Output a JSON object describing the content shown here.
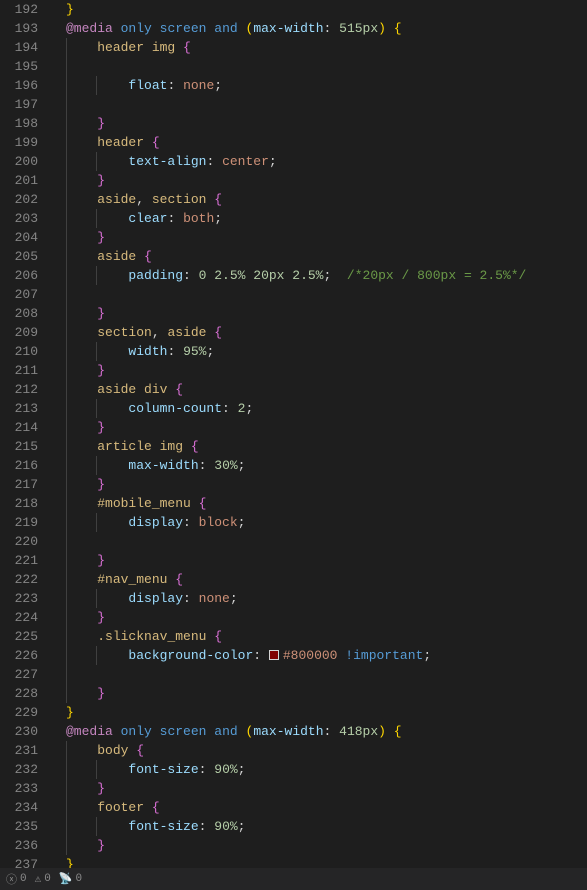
{
  "gutter": {
    "start": 192,
    "end": 237
  },
  "lines": [
    {
      "indent": 0,
      "tokens": [
        {
          "t": "paren-y",
          "v": "}"
        }
      ]
    },
    {
      "indent": 0,
      "tokens": [
        {
          "t": "atrule",
          "v": "@media"
        },
        {
          "t": "sp"
        },
        {
          "t": "keyword",
          "v": "only"
        },
        {
          "t": "sp"
        },
        {
          "t": "keyword",
          "v": "screen"
        },
        {
          "t": "sp"
        },
        {
          "t": "keyword",
          "v": "and"
        },
        {
          "t": "sp"
        },
        {
          "t": "paren-y",
          "v": "("
        },
        {
          "t": "prop",
          "v": "max-width"
        },
        {
          "t": "punct",
          "v": ":"
        },
        {
          "t": "sp"
        },
        {
          "t": "num",
          "v": "515px"
        },
        {
          "t": "paren-y",
          "v": ")"
        },
        {
          "t": "sp"
        },
        {
          "t": "paren-y",
          "v": "{"
        }
      ]
    },
    {
      "indent": 1,
      "tokens": [
        {
          "t": "sel",
          "v": "header img"
        },
        {
          "t": "sp"
        },
        {
          "t": "paren-p",
          "v": "{"
        }
      ]
    },
    {
      "indent": 1,
      "tokens": []
    },
    {
      "indent": 2,
      "tokens": [
        {
          "t": "prop",
          "v": "float"
        },
        {
          "t": "punct",
          "v": ":"
        },
        {
          "t": "sp"
        },
        {
          "t": "val",
          "v": "none"
        },
        {
          "t": "punct",
          "v": ";"
        }
      ]
    },
    {
      "indent": 1,
      "tokens": []
    },
    {
      "indent": 1,
      "tokens": [
        {
          "t": "paren-p",
          "v": "}"
        }
      ]
    },
    {
      "indent": 1,
      "tokens": [
        {
          "t": "sel",
          "v": "header"
        },
        {
          "t": "sp"
        },
        {
          "t": "paren-p",
          "v": "{"
        }
      ]
    },
    {
      "indent": 2,
      "tokens": [
        {
          "t": "prop",
          "v": "text-align"
        },
        {
          "t": "punct",
          "v": ":"
        },
        {
          "t": "sp"
        },
        {
          "t": "val",
          "v": "center"
        },
        {
          "t": "punct",
          "v": ";"
        }
      ]
    },
    {
      "indent": 1,
      "tokens": [
        {
          "t": "paren-p",
          "v": "}"
        }
      ]
    },
    {
      "indent": 1,
      "tokens": [
        {
          "t": "sel",
          "v": "aside"
        },
        {
          "t": "punct",
          "v": ","
        },
        {
          "t": "sp"
        },
        {
          "t": "sel",
          "v": "section"
        },
        {
          "t": "sp"
        },
        {
          "t": "paren-p",
          "v": "{"
        }
      ]
    },
    {
      "indent": 2,
      "tokens": [
        {
          "t": "prop",
          "v": "clear"
        },
        {
          "t": "punct",
          "v": ":"
        },
        {
          "t": "sp"
        },
        {
          "t": "val",
          "v": "both"
        },
        {
          "t": "punct",
          "v": ";"
        }
      ]
    },
    {
      "indent": 1,
      "tokens": [
        {
          "t": "paren-p",
          "v": "}"
        }
      ]
    },
    {
      "indent": 1,
      "tokens": [
        {
          "t": "sel",
          "v": "aside"
        },
        {
          "t": "sp"
        },
        {
          "t": "paren-p",
          "v": "{"
        }
      ]
    },
    {
      "indent": 2,
      "tokens": [
        {
          "t": "prop",
          "v": "padding"
        },
        {
          "t": "punct",
          "v": ":"
        },
        {
          "t": "sp"
        },
        {
          "t": "num",
          "v": "0 2.5% 20px 2.5%"
        },
        {
          "t": "punct",
          "v": ";"
        },
        {
          "t": "sp"
        },
        {
          "t": "sp"
        },
        {
          "t": "comment",
          "v": "/*20px / 800px = 2.5%*/"
        }
      ]
    },
    {
      "indent": 1,
      "tokens": []
    },
    {
      "indent": 1,
      "tokens": [
        {
          "t": "paren-p",
          "v": "}"
        }
      ]
    },
    {
      "indent": 1,
      "tokens": [
        {
          "t": "sel",
          "v": "section"
        },
        {
          "t": "punct",
          "v": ","
        },
        {
          "t": "sp"
        },
        {
          "t": "sel",
          "v": "aside"
        },
        {
          "t": "sp"
        },
        {
          "t": "paren-p",
          "v": "{"
        }
      ]
    },
    {
      "indent": 2,
      "tokens": [
        {
          "t": "prop",
          "v": "width"
        },
        {
          "t": "punct",
          "v": ":"
        },
        {
          "t": "sp"
        },
        {
          "t": "num",
          "v": "95%"
        },
        {
          "t": "punct",
          "v": ";"
        }
      ]
    },
    {
      "indent": 1,
      "tokens": [
        {
          "t": "paren-p",
          "v": "}"
        }
      ]
    },
    {
      "indent": 1,
      "tokens": [
        {
          "t": "sel",
          "v": "aside div"
        },
        {
          "t": "sp"
        },
        {
          "t": "paren-p",
          "v": "{"
        }
      ]
    },
    {
      "indent": 2,
      "tokens": [
        {
          "t": "prop",
          "v": "column-count"
        },
        {
          "t": "punct",
          "v": ":"
        },
        {
          "t": "sp"
        },
        {
          "t": "num",
          "v": "2"
        },
        {
          "t": "punct",
          "v": ";"
        }
      ]
    },
    {
      "indent": 1,
      "tokens": [
        {
          "t": "paren-p",
          "v": "}"
        }
      ]
    },
    {
      "indent": 1,
      "tokens": [
        {
          "t": "sel",
          "v": "article img"
        },
        {
          "t": "sp"
        },
        {
          "t": "paren-p",
          "v": "{"
        }
      ]
    },
    {
      "indent": 2,
      "tokens": [
        {
          "t": "prop",
          "v": "max-width"
        },
        {
          "t": "punct",
          "v": ":"
        },
        {
          "t": "sp"
        },
        {
          "t": "num",
          "v": "30%"
        },
        {
          "t": "punct",
          "v": ";"
        }
      ]
    },
    {
      "indent": 1,
      "tokens": [
        {
          "t": "paren-p",
          "v": "}"
        }
      ]
    },
    {
      "indent": 1,
      "tokens": [
        {
          "t": "sel",
          "v": "#mobile_menu"
        },
        {
          "t": "sp"
        },
        {
          "t": "paren-p",
          "v": "{"
        }
      ]
    },
    {
      "indent": 2,
      "tokens": [
        {
          "t": "prop",
          "v": "display"
        },
        {
          "t": "punct",
          "v": ":"
        },
        {
          "t": "sp"
        },
        {
          "t": "val",
          "v": "block"
        },
        {
          "t": "punct",
          "v": ";"
        }
      ]
    },
    {
      "indent": 1,
      "tokens": []
    },
    {
      "indent": 1,
      "tokens": [
        {
          "t": "paren-p",
          "v": "}"
        }
      ]
    },
    {
      "indent": 1,
      "tokens": [
        {
          "t": "sel",
          "v": "#nav_menu"
        },
        {
          "t": "sp"
        },
        {
          "t": "paren-p",
          "v": "{"
        }
      ]
    },
    {
      "indent": 2,
      "tokens": [
        {
          "t": "prop",
          "v": "display"
        },
        {
          "t": "punct",
          "v": ":"
        },
        {
          "t": "sp"
        },
        {
          "t": "val",
          "v": "none"
        },
        {
          "t": "punct",
          "v": ";"
        }
      ]
    },
    {
      "indent": 1,
      "tokens": [
        {
          "t": "paren-p",
          "v": "}"
        }
      ]
    },
    {
      "indent": 1,
      "tokens": [
        {
          "t": "sel",
          "v": ".slicknav_menu"
        },
        {
          "t": "sp"
        },
        {
          "t": "paren-p",
          "v": "{"
        }
      ]
    },
    {
      "indent": 2,
      "tokens": [
        {
          "t": "prop",
          "v": "background-color"
        },
        {
          "t": "punct",
          "v": ":"
        },
        {
          "t": "sp"
        },
        {
          "t": "swatch",
          "v": "#800000"
        },
        {
          "t": "val",
          "v": "#800000"
        },
        {
          "t": "sp"
        },
        {
          "t": "important",
          "v": "!important"
        },
        {
          "t": "punct",
          "v": ";"
        }
      ]
    },
    {
      "indent": 1,
      "tokens": []
    },
    {
      "indent": 1,
      "tokens": [
        {
          "t": "paren-p",
          "v": "}"
        }
      ]
    },
    {
      "indent": 0,
      "tokens": [
        {
          "t": "paren-y",
          "v": "}"
        }
      ]
    },
    {
      "indent": 0,
      "tokens": [
        {
          "t": "atrule",
          "v": "@media"
        },
        {
          "t": "sp"
        },
        {
          "t": "keyword",
          "v": "only"
        },
        {
          "t": "sp"
        },
        {
          "t": "keyword",
          "v": "screen"
        },
        {
          "t": "sp"
        },
        {
          "t": "keyword",
          "v": "and"
        },
        {
          "t": "sp"
        },
        {
          "t": "paren-y",
          "v": "("
        },
        {
          "t": "prop",
          "v": "max-width"
        },
        {
          "t": "punct",
          "v": ":"
        },
        {
          "t": "sp"
        },
        {
          "t": "num",
          "v": "418px"
        },
        {
          "t": "paren-y",
          "v": ")"
        },
        {
          "t": "sp"
        },
        {
          "t": "paren-y",
          "v": "{"
        }
      ]
    },
    {
      "indent": 1,
      "tokens": [
        {
          "t": "sel",
          "v": "body"
        },
        {
          "t": "sp"
        },
        {
          "t": "paren-p",
          "v": "{"
        }
      ]
    },
    {
      "indent": 2,
      "tokens": [
        {
          "t": "prop",
          "v": "font-size"
        },
        {
          "t": "punct",
          "v": ":"
        },
        {
          "t": "sp"
        },
        {
          "t": "num",
          "v": "90%"
        },
        {
          "t": "punct",
          "v": ";"
        }
      ]
    },
    {
      "indent": 1,
      "tokens": [
        {
          "t": "paren-p",
          "v": "}"
        }
      ]
    },
    {
      "indent": 1,
      "tokens": [
        {
          "t": "sel",
          "v": "footer"
        },
        {
          "t": "sp"
        },
        {
          "t": "paren-p",
          "v": "{"
        }
      ]
    },
    {
      "indent": 2,
      "tokens": [
        {
          "t": "prop",
          "v": "font-size"
        },
        {
          "t": "punct",
          "v": ":"
        },
        {
          "t": "sp"
        },
        {
          "t": "num",
          "v": "90%"
        },
        {
          "t": "punct",
          "v": ";"
        }
      ]
    },
    {
      "indent": 1,
      "tokens": [
        {
          "t": "paren-p",
          "v": "}"
        }
      ]
    },
    {
      "indent": 0,
      "tokens": [
        {
          "t": "paren-y",
          "v": "}"
        }
      ]
    }
  ],
  "statusbar": {
    "errors": "0",
    "warnings": "0",
    "ports": "0"
  }
}
